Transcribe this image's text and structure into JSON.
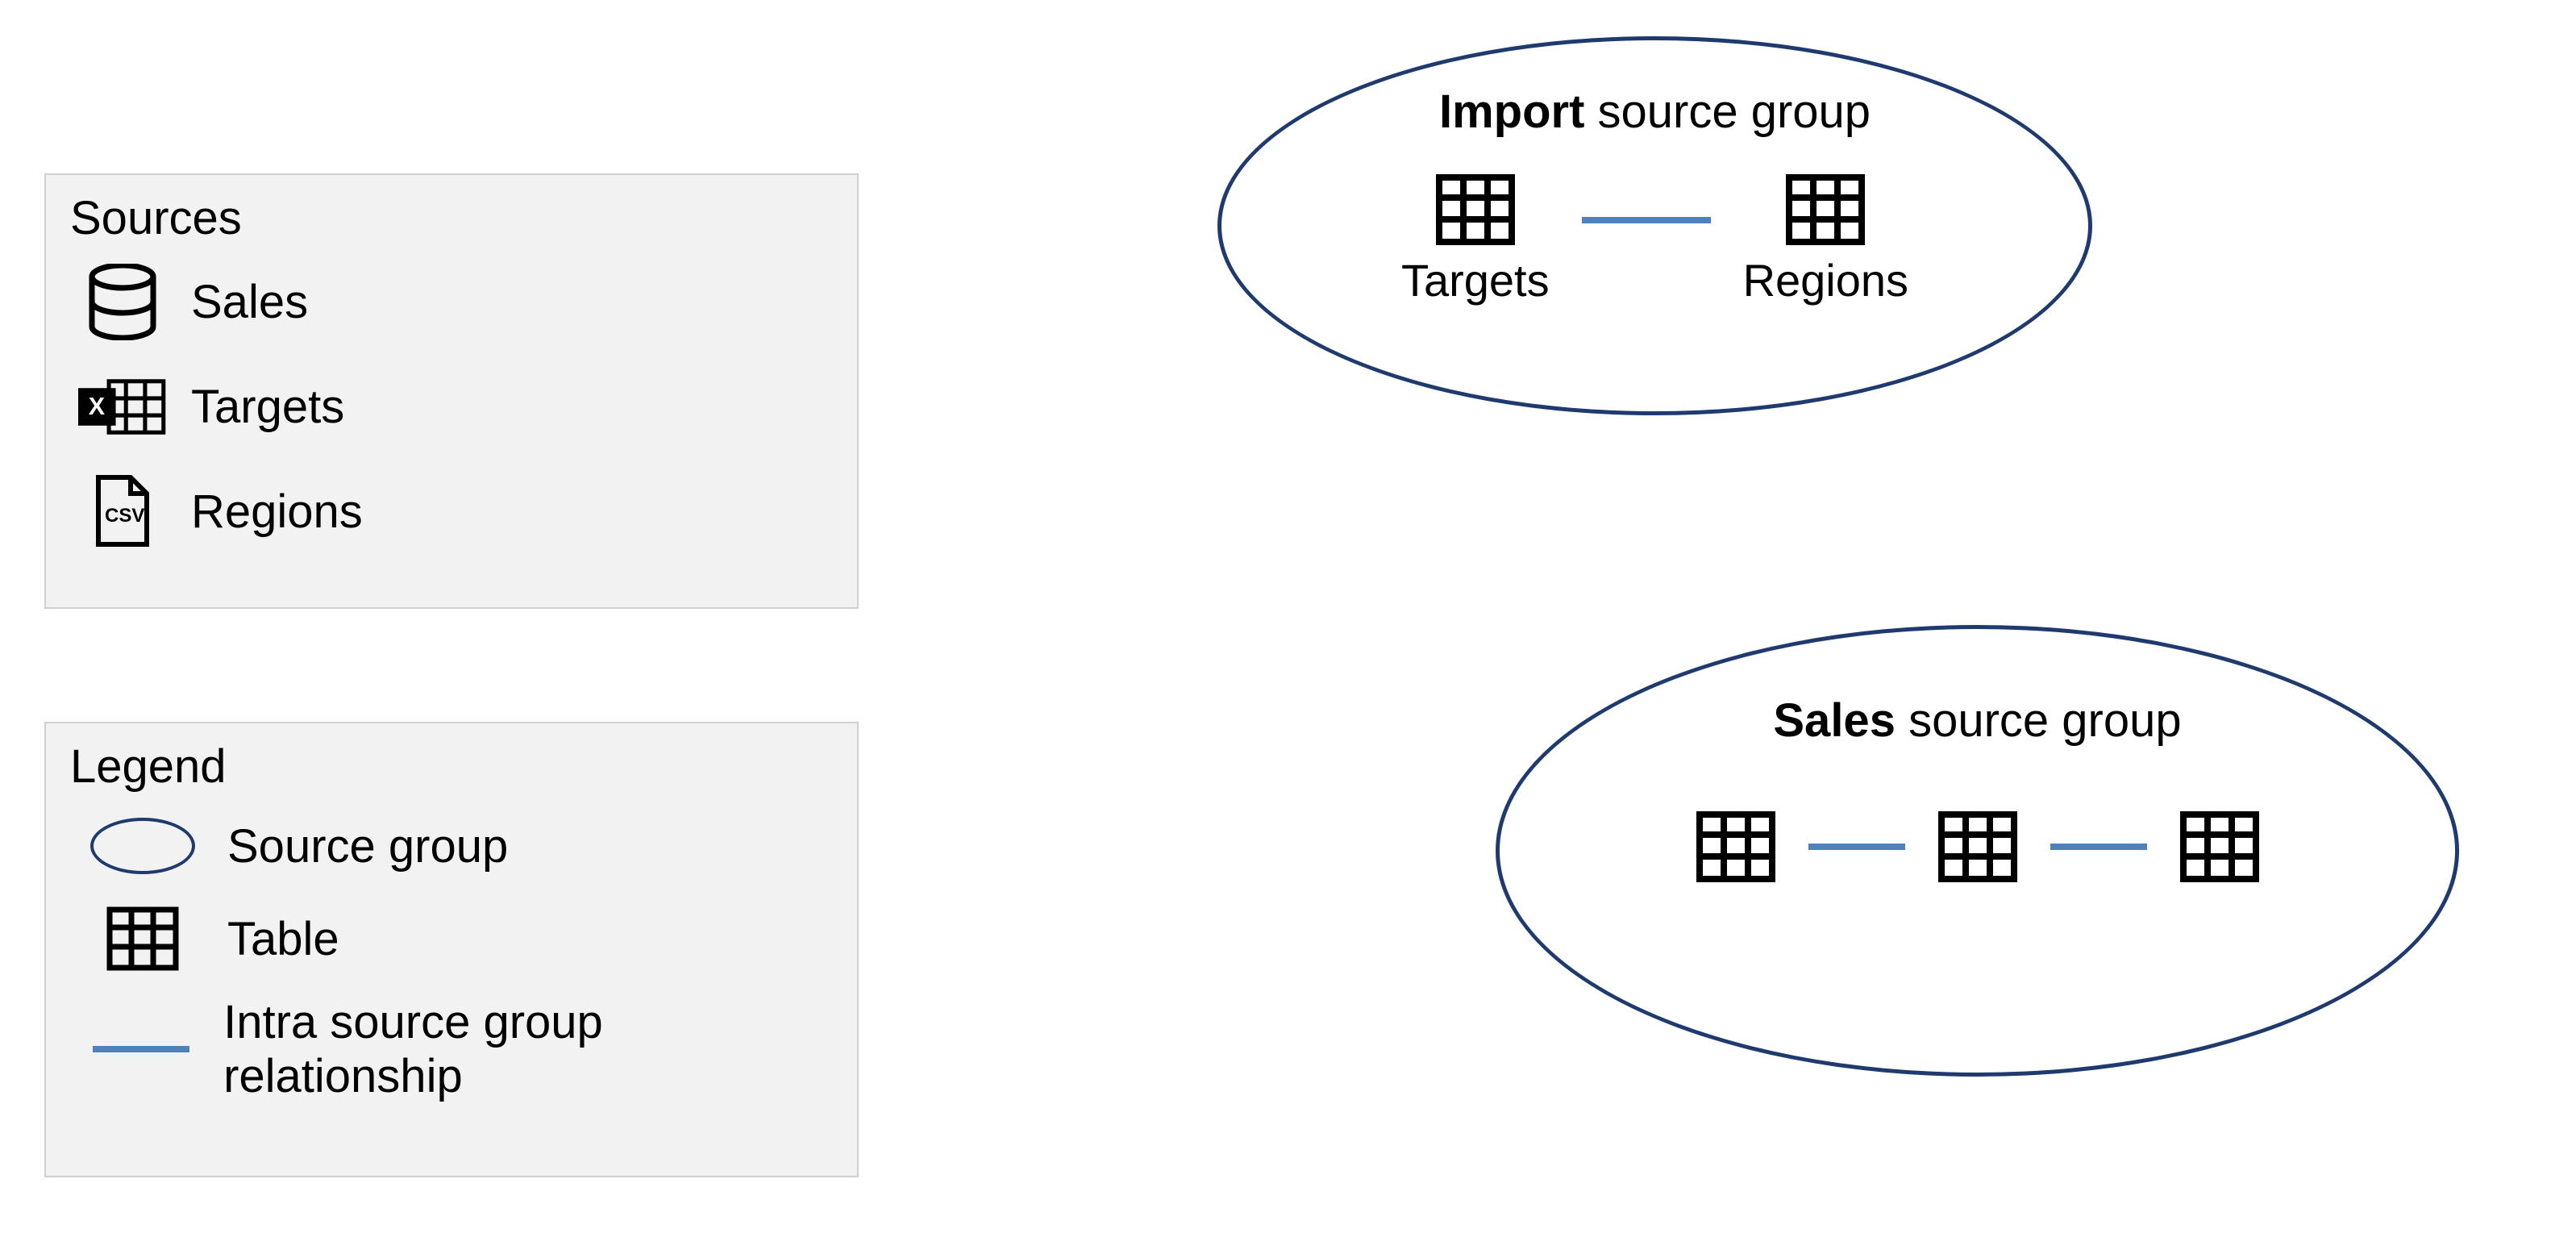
{
  "sources": {
    "title": "Sources",
    "items": [
      {
        "label": "Sales",
        "icon": "database"
      },
      {
        "label": "Targets",
        "icon": "excel"
      },
      {
        "label": "Regions",
        "icon": "csv"
      }
    ]
  },
  "legend": {
    "title": "Legend",
    "items": [
      {
        "label": "Source group",
        "icon": "ellipse"
      },
      {
        "label": "Table",
        "icon": "table"
      },
      {
        "label": "Intra source group relationship",
        "icon": "line"
      }
    ]
  },
  "groups": {
    "import": {
      "titleBold": "Import",
      "titleRest": " source group",
      "tables": [
        "Targets",
        "Regions"
      ]
    },
    "sales": {
      "titleBold": "Sales",
      "titleRest": " source group",
      "tableCount": 3
    }
  }
}
